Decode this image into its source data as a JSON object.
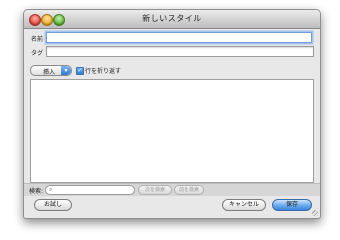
{
  "window": {
    "title": "新しいスタイル"
  },
  "fields": {
    "name_label": "名前",
    "name_value": "",
    "tag_label": "タグ",
    "tag_value": ""
  },
  "toolbar": {
    "insert_label": "挿入",
    "wrap_label": "行を折り返す",
    "wrap_checked": true
  },
  "editor": {
    "content": ""
  },
  "searchbar": {
    "label": "検索:",
    "value": "",
    "prev_label": "次を検索",
    "next_label": "前を検索"
  },
  "buttons": {
    "try_label": "お試し",
    "cancel_label": "キャンセル",
    "save_label": "保存"
  },
  "colors": {
    "accent": "#4a8fe0",
    "focus_ring": "#a5c5ef"
  }
}
